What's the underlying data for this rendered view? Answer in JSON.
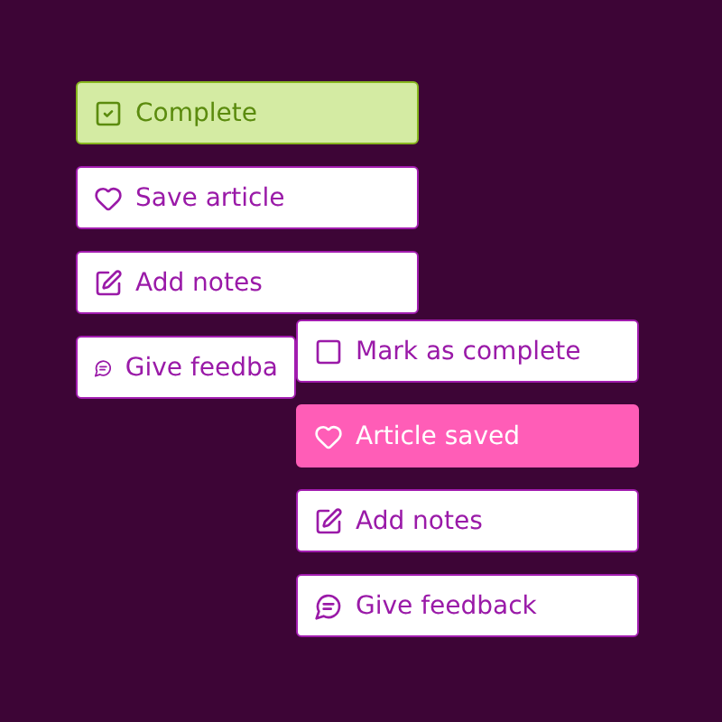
{
  "groups": [
    {
      "buttons": [
        {
          "kind": "complete",
          "label": "Complete",
          "on": true
        },
        {
          "kind": "save",
          "label": "Save article",
          "on": false
        },
        {
          "kind": "notes",
          "label": "Add notes"
        },
        {
          "kind": "feedback",
          "label": "Give feedba"
        }
      ]
    },
    {
      "buttons": [
        {
          "kind": "complete",
          "label": "Mark as complete",
          "on": false
        },
        {
          "kind": "save",
          "label": "Article saved",
          "on": true
        },
        {
          "kind": "notes",
          "label": "Add notes"
        },
        {
          "kind": "feedback",
          "label": "Give feedback"
        }
      ]
    }
  ]
}
